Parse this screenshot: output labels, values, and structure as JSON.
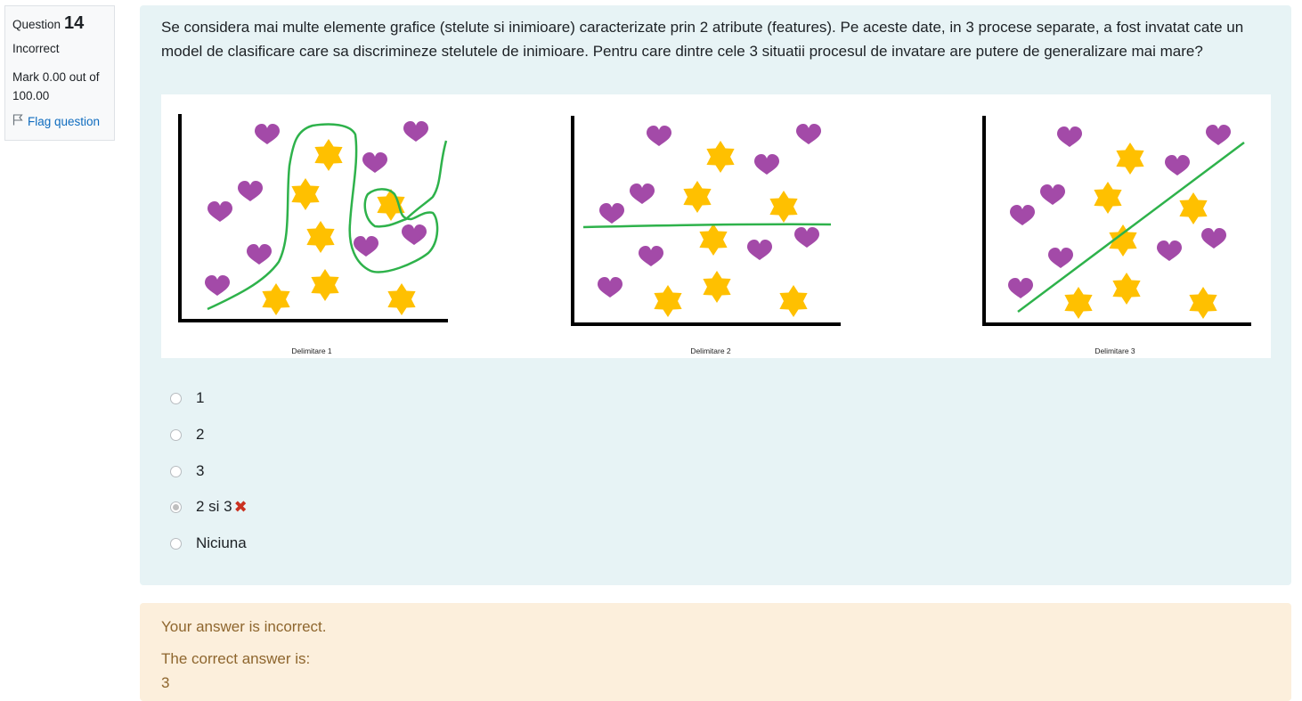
{
  "info": {
    "question_label": "Question",
    "question_number": "14",
    "state": "Incorrect",
    "grade": "Mark 0.00 out of 100.00",
    "flag_label": "Flag question"
  },
  "question": {
    "text": "Se considera mai multe elemente grafice (stelute si inimioare) caracterizate prin 2 atribute (features). Pe aceste date, in 3 procese separate, a fost invatat cate un model de clasificare care sa discrimineze stelutele de inimioare. Pentru care dintre cele 3 situatii procesul de invatare are putere de generalizare mai mare?",
    "panels": [
      {
        "caption": "Delimitare 1"
      },
      {
        "caption": "Delimitare 2"
      },
      {
        "caption": "Delimitare  3"
      }
    ]
  },
  "answers": [
    {
      "label": "1",
      "selected": false,
      "marked_incorrect": false
    },
    {
      "label": "2",
      "selected": false,
      "marked_incorrect": false
    },
    {
      "label": "3",
      "selected": false,
      "marked_incorrect": false
    },
    {
      "label": "2 si 3",
      "selected": true,
      "marked_incorrect": true
    },
    {
      "label": "Niciuna",
      "selected": false,
      "marked_incorrect": false
    }
  ],
  "feedback": {
    "result": "Your answer is incorrect.",
    "correct_label": "The correct answer is:",
    "correct_value": "3"
  },
  "colors": {
    "heart": "#a34aa8",
    "star": "#ffc000",
    "boundary": "#2eb24b",
    "info_bg": "#f8f9fa",
    "question_bg": "#e7f3f5",
    "feedback_bg": "#fcefdc",
    "feedback_text": "#8e662e",
    "link": "#0f6cbf",
    "incorrect_icon": "#ca3120"
  },
  "icons": {
    "flag": "flag-icon",
    "incorrect": "cross-icon"
  }
}
